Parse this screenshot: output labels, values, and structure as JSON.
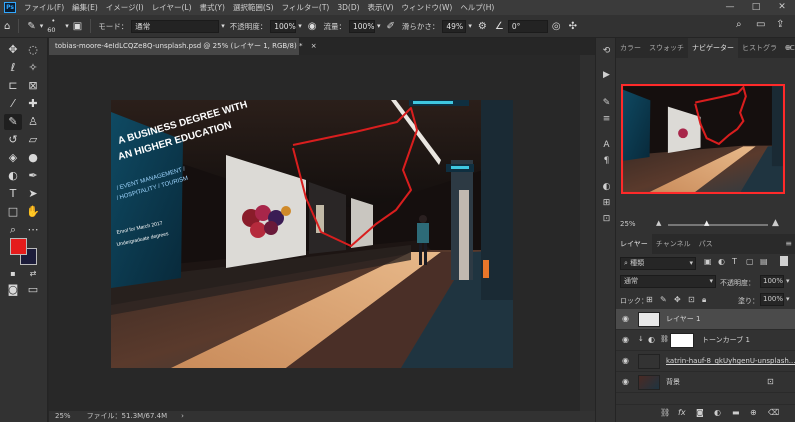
{
  "menu": {
    "items": [
      "ファイル(F)",
      "編集(E)",
      "イメージ(I)",
      "レイヤー(L)",
      "書式(Y)",
      "選択範囲(S)",
      "フィルター(T)",
      "3D(D)",
      "表示(V)",
      "ウィンドウ(W)",
      "ヘルプ(H)"
    ],
    "minimize": "—",
    "maximize": "□",
    "close": "✕"
  },
  "options": {
    "brush_size": "60",
    "mode_label": "モード：",
    "mode_value": "通常",
    "opacity_label": "不透明度：",
    "opacity_value": "100%",
    "flow_label": "流量：",
    "flow_value": "100%",
    "smoothing_label": "滑らかさ：",
    "smoothing_value": "49%",
    "angle_value": "0°"
  },
  "document": {
    "tab_title": "tobias-moore-4eIdLCQZe8Q-unsplash.psd @ 25% (レイヤー 1, RGB/8) *",
    "tab_close": "×"
  },
  "status": {
    "zoom": "25%",
    "file_info": "ファイル：51.3M/67.4M",
    "arrow": "›"
  },
  "colors": {
    "foreground": "#e51c1c",
    "background": "#1c1c3a",
    "accent": "#31a8ff",
    "stroke": "#d91e1e"
  },
  "photo": {
    "billboard_line1": "A BUSINESS DEGREE WITH",
    "billboard_line2": "AN HIGHER EDUCATION",
    "billboard_line3": "/ EVENT MANAGEMENT /",
    "billboard_line4": "/ HOSPITALITY / TOURISM",
    "billboard_line5": "Enrol for March 2017",
    "billboard_line6": "Undergraduate degrees"
  },
  "right_panel": {
    "top_tabs": [
      "カラー",
      "スウォッチ",
      "ナビゲーター",
      "ヒストグラ",
      "CC ライブ"
    ],
    "active_top_tab": "ナビゲーター",
    "nav_zoom": "25%",
    "layer_tabs": [
      "レイヤー",
      "チャンネル",
      "パス"
    ],
    "active_layer_tab": "レイヤー",
    "filter_kind": "種類",
    "blend_mode": "通常",
    "opacity_label": "不透明度：",
    "opacity_value": "100%",
    "lock_label": "ロック：",
    "fill_label": "塗り：",
    "fill_value": "100%",
    "layers": [
      {
        "name": "レイヤー 1",
        "selected": true
      },
      {
        "name": "トーンカーブ 1",
        "selected": false
      },
      {
        "name": "katrin-hauf-8_qkUyhgenU-unsplash...",
        "selected": false
      },
      {
        "name": "背景",
        "selected": false
      }
    ],
    "footer_icons": [
      "link-icon",
      "fx-icon",
      "mask-icon",
      "adjustment-icon",
      "folder-icon",
      "new-layer-icon",
      "trash-icon"
    ]
  }
}
